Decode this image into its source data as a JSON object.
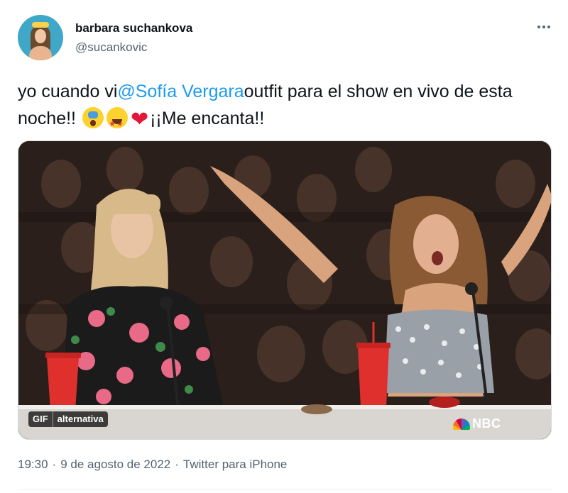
{
  "user": {
    "display_name": "barbara suchankova",
    "handle": "@sucankovic"
  },
  "tweet": {
    "text_part1": "yo cuando vi",
    "mention": "@Sofía Vergara",
    "text_part2": "outfit para el show en vivo de esta noche!! ",
    "emojis": [
      "face-screaming-icon",
      "star-struck-icon",
      "red-heart-icon"
    ],
    "text_part3": "¡¡Me encanta!!"
  },
  "media": {
    "type": "GIF",
    "gif_label": "GIF",
    "alt_label": "alternativa",
    "network_logo": "NBC"
  },
  "meta": {
    "time": "19:30",
    "separator1": "·",
    "date": "9 de agosto de 2022",
    "separator2": "·",
    "source": "Twitter para iPhone"
  },
  "colors": {
    "link": "#1d9bf0",
    "secondary_text": "#536471",
    "primary_text": "#0f1419"
  }
}
